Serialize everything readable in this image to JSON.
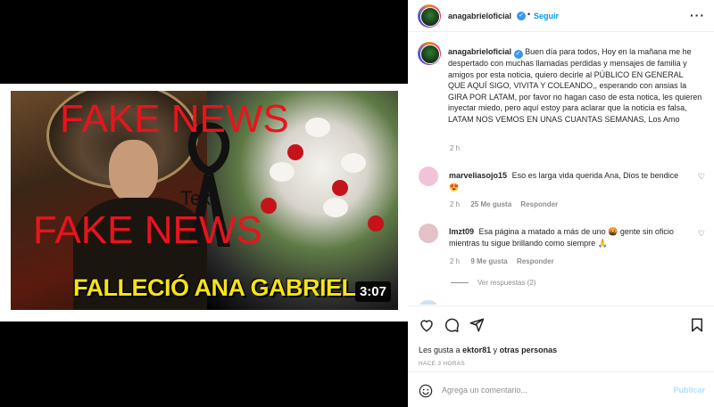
{
  "media": {
    "overlay_top": "FAKE NEWS",
    "overlay_bottom": "FAKE NEWS",
    "watermark": "Text",
    "title": "FALLECIÓ ANA GABRIEL",
    "duration": "3:07"
  },
  "header": {
    "username": "anagabrieloficial",
    "verified_icon": "verified-badge-icon",
    "separator": "•",
    "follow_label": "Seguir",
    "more_label": "···"
  },
  "caption": {
    "username": "anagabrieloficial",
    "text": "Buen día para todos, Hoy en la mañana me he despertado con muchas llamadas perdidas y mensajes de familia y amigos por esta noticia, quiero decirle al PÚBLICO EN GENERAL QUE AQUÍ SIGO, VIVITA Y COLEANDO,, esperando con ansias la GIRA POR LATAM, por favor no hagan caso de esta notica, les quieren inyectar miedo, pero aquí estoy para aclarar que la noticia es falsa, LATAM NOS VEMOS EN UNAS CUANTAS SEMANAS, Los Amo",
    "time": "2 h"
  },
  "comments": [
    {
      "username": "marveliasojo15",
      "text": "Eso es larga vida querida Ana, Dios te bendice",
      "emoji": "😍",
      "time": "2 h",
      "likes": "25 Me gusta",
      "reply": "Responder"
    },
    {
      "username": "lmzt09",
      "text": "Esa página a matado a más de uno 🤬 gente sin oficio mientras tu sigue brillando como siempre 🙏",
      "time": "2 h",
      "likes": "9 Me gusta",
      "reply": "Responder",
      "view_replies": "Ver respuestas (2)"
    }
  ],
  "actions": {
    "like_icon": "heart-icon",
    "comment_icon": "comment-icon",
    "share_icon": "send-icon",
    "save_icon": "bookmark-icon",
    "likes_prefix": "Les gusta a",
    "likes_user": "ektor81",
    "likes_mid": "y",
    "likes_others": "otras personas",
    "posted_ago": "HACE 3 HORAS"
  },
  "comment_box": {
    "emoji_icon": "smiley-icon",
    "placeholder": "Agrega un comentario...",
    "publish_label": "Publicar"
  },
  "colors": {
    "accent": "#0095f6",
    "publish_disabled": "#b2dffc",
    "overlay_red": "#e8141d",
    "title_yellow": "#f5e21a"
  }
}
